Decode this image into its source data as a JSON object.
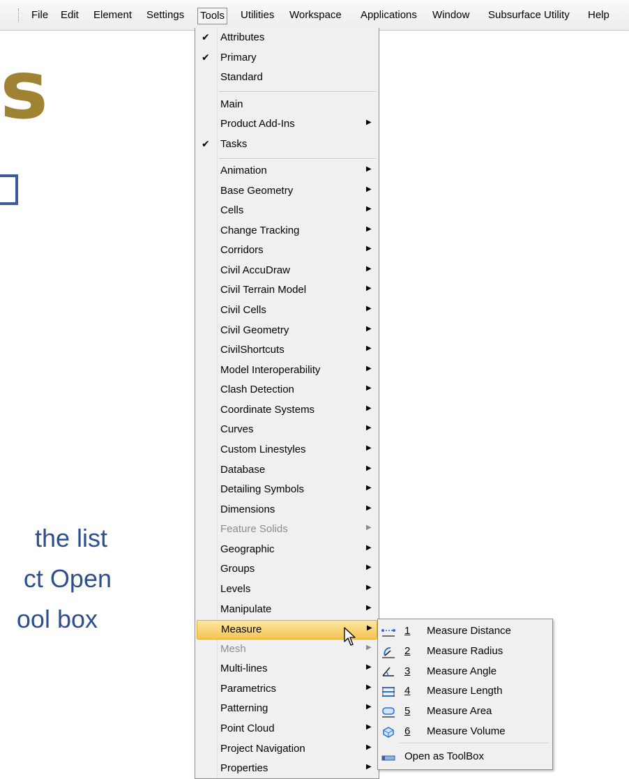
{
  "slide": {
    "big_letter": "s",
    "lines": [
      "the list",
      "ct Open",
      "ool box"
    ]
  },
  "menubar": {
    "items": [
      {
        "label": "File",
        "active": false
      },
      {
        "label": "Edit",
        "active": false
      },
      {
        "label": "Element",
        "active": false
      },
      {
        "label": "Settings",
        "active": false
      },
      {
        "label": "Tools",
        "active": true
      },
      {
        "label": "Utilities",
        "active": false
      },
      {
        "label": "Workspace",
        "active": false
      },
      {
        "label": "Applications",
        "active": false
      },
      {
        "label": "Window",
        "active": false
      },
      {
        "label": "Subsurface Utility",
        "active": false
      },
      {
        "label": "Help",
        "active": false
      }
    ]
  },
  "tools_menu": {
    "group1": [
      {
        "label": "Attributes",
        "checked": true
      },
      {
        "label": "Primary",
        "checked": true
      },
      {
        "label": "Standard",
        "checked": false
      }
    ],
    "group2": [
      {
        "label": "Main",
        "checked": false,
        "submenu": false
      },
      {
        "label": "Product Add-Ins",
        "checked": false,
        "submenu": true
      },
      {
        "label": "Tasks",
        "checked": true,
        "submenu": false
      }
    ],
    "group3": [
      {
        "label": "Animation",
        "disabled": false
      },
      {
        "label": "Base Geometry",
        "disabled": false
      },
      {
        "label": "Cells",
        "disabled": false
      },
      {
        "label": "Change Tracking",
        "disabled": false
      },
      {
        "label": "Corridors",
        "disabled": false
      },
      {
        "label": "Civil AccuDraw",
        "disabled": false
      },
      {
        "label": "Civil Terrain Model",
        "disabled": false
      },
      {
        "label": "Civil Cells",
        "disabled": false
      },
      {
        "label": "Civil Geometry",
        "disabled": false
      },
      {
        "label": "CivilShortcuts",
        "disabled": false
      },
      {
        "label": "Model Interoperability",
        "disabled": false
      },
      {
        "label": "Clash Detection",
        "disabled": false
      },
      {
        "label": "Coordinate Systems",
        "disabled": false
      },
      {
        "label": "Curves",
        "disabled": false
      },
      {
        "label": "Custom Linestyles",
        "disabled": false
      },
      {
        "label": "Database",
        "disabled": false
      },
      {
        "label": "Detailing Symbols",
        "disabled": false
      },
      {
        "label": "Dimensions",
        "disabled": false
      },
      {
        "label": "Feature Solids",
        "disabled": true
      },
      {
        "label": "Geographic",
        "disabled": false
      },
      {
        "label": "Groups",
        "disabled": false
      },
      {
        "label": "Levels",
        "disabled": false
      },
      {
        "label": "Manipulate",
        "disabled": false
      },
      {
        "label": "Measure",
        "disabled": false,
        "active": true
      },
      {
        "label": "Mesh",
        "disabled": true
      },
      {
        "label": "Multi-lines",
        "disabled": false
      },
      {
        "label": "Parametrics",
        "disabled": false
      },
      {
        "label": "Patterning",
        "disabled": false
      },
      {
        "label": "Point Cloud",
        "disabled": false
      },
      {
        "label": "Project Navigation",
        "disabled": false
      },
      {
        "label": "Properties",
        "disabled": false
      }
    ]
  },
  "measure_submenu": {
    "items": [
      {
        "num": "1",
        "label": "Measure Distance",
        "icon": "measure-distance-icon"
      },
      {
        "num": "2",
        "label": "Measure Radius",
        "icon": "measure-radius-icon"
      },
      {
        "num": "3",
        "label": "Measure Angle",
        "icon": "measure-angle-icon"
      },
      {
        "num": "4",
        "label": "Measure Length",
        "icon": "measure-length-icon"
      },
      {
        "num": "5",
        "label": "Measure Area",
        "icon": "measure-area-icon"
      },
      {
        "num": "6",
        "label": "Measure Volume",
        "icon": "measure-volume-icon"
      }
    ],
    "open_toolbox": {
      "label": "Open as ToolBox",
      "icon": "toolbox-icon"
    }
  }
}
